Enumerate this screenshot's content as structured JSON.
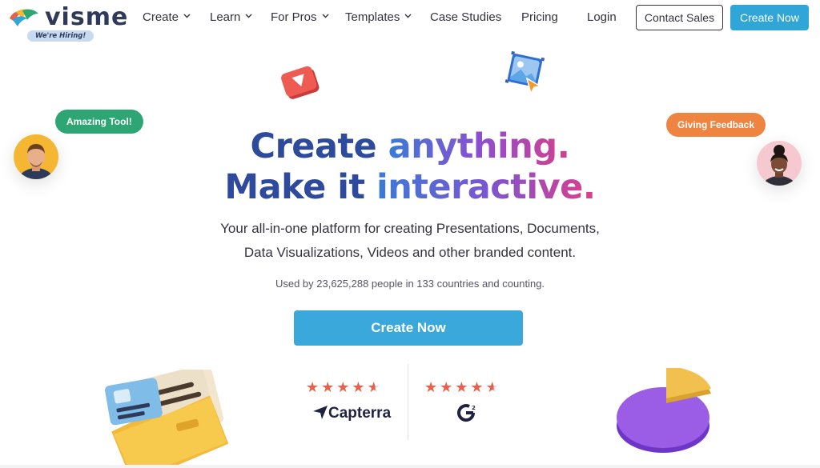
{
  "brand": {
    "name": "visme",
    "hiring_badge": "We're Hiring!"
  },
  "nav": {
    "items": [
      {
        "label": "Create",
        "dropdown": true
      },
      {
        "label": "Learn",
        "dropdown": true
      },
      {
        "label": "For Pros",
        "dropdown": true
      },
      {
        "label": "Templates",
        "dropdown": true
      },
      {
        "label": "Case Studies",
        "dropdown": false
      },
      {
        "label": "Pricing",
        "dropdown": false
      },
      {
        "label": "Login",
        "dropdown": false
      }
    ],
    "contact_sales": "Contact Sales",
    "create_now": "Create Now"
  },
  "hero": {
    "line1_a": "Create ",
    "line1_b": "anything.",
    "line2_a": "Make it ",
    "line2_b": "interactive.",
    "subtitle_1": "Your all-in-one platform for creating Presentations, Documents,",
    "subtitle_2": "Data Visualizations, Videos and other branded content.",
    "used_by": "Used by 23,625,288 people in 133 countries and counting.",
    "cta": "Create Now"
  },
  "bubbles": {
    "left": "Amazing Tool!",
    "right": "Giving Feedback"
  },
  "ratings": [
    {
      "source": "Capterra",
      "stars": 4.5
    },
    {
      "source": "G2",
      "stars": 4.5
    }
  ],
  "colors": {
    "accent": "#2fa5d8",
    "headline_dark": "#2d4a9c",
    "bubble_green": "#2ea673",
    "bubble_orange": "#ef8340",
    "star": "#e8604c"
  },
  "icons": [
    "logo-icon",
    "chevron-down-icon",
    "play-icon",
    "image-icon",
    "cursor-icon",
    "folder-icon",
    "pie-chart-icon",
    "star-icon",
    "capterra-logo-icon",
    "g2-logo-icon"
  ]
}
